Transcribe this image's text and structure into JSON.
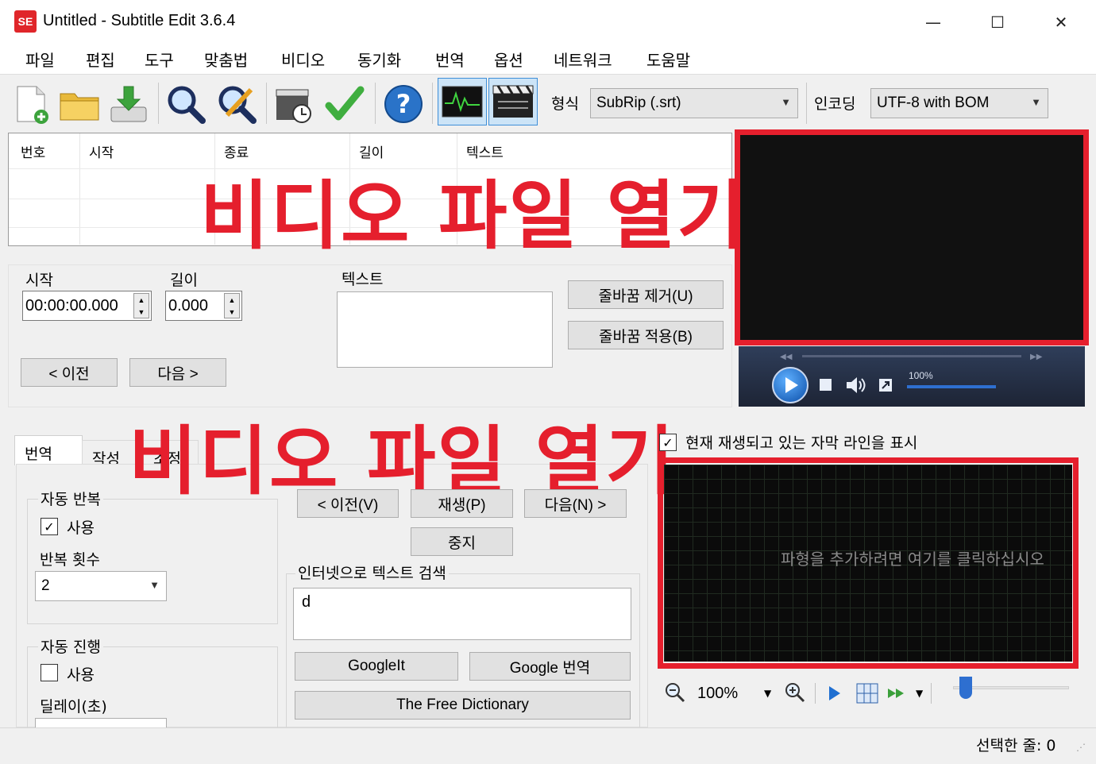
{
  "window": {
    "icon_text": "SE",
    "title": "Untitled - Subtitle Edit 3.6.4",
    "minimize": "—",
    "maximize": "☐",
    "close": "✕"
  },
  "menu": [
    "파일",
    "편집",
    "도구",
    "맞춤법",
    "비디오",
    "동기화",
    "번역",
    "옵션",
    "네트워크",
    "도움말"
  ],
  "toolbar": {
    "format_label": "형식",
    "format_value": "SubRip (.srt)",
    "encoding_label": "인코딩",
    "encoding_value": "UTF-8 with BOM",
    "icons": [
      "new-file-icon",
      "open-folder-icon",
      "save-icon",
      "find-icon",
      "replace-icon",
      "visual-sync-icon",
      "spell-check-icon",
      "help-icon",
      "waveform-toggle-icon",
      "video-toggle-icon"
    ]
  },
  "subtitle_list": {
    "columns": [
      "번호",
      "시작",
      "종료",
      "길이",
      "텍스트"
    ]
  },
  "overlay": {
    "top_text": "비디오 파일 열기",
    "middle_text": "비디오 파일 열기"
  },
  "edit": {
    "start_label": "시작",
    "start_value": "00:00:00.000",
    "duration_label": "길이",
    "duration_value": "0.000",
    "text_label": "텍스트",
    "prev_button": "< 이전",
    "next_button": "다음 >",
    "remove_linebreak": "줄바꿈 제거(U)",
    "apply_linebreak": "줄바꿈 적용(B)"
  },
  "player": {
    "volume_percent": "100%"
  },
  "tabs": {
    "items": [
      "번역",
      "작성",
      "조정"
    ],
    "auto_repeat": {
      "title": "자동 반복",
      "use_label": "사용",
      "use_checked": "✓",
      "count_label": "반복 횟수",
      "count_value": "2"
    },
    "auto_continue": {
      "title": "자동 진행",
      "use_label": "사용",
      "delay_label": "딜레이(초)"
    },
    "nav": {
      "prev": "< 이전(V)",
      "play": "재생(P)",
      "next": "다음(N) >",
      "stop": "중지"
    },
    "search": {
      "title": "인터넷으로 텍스트 검색",
      "value": "d",
      "googleit": "GoogleIt",
      "google_translate": "Google 번역",
      "free_dictionary": "The Free Dictionary"
    }
  },
  "waveform": {
    "show_current_line_label": "현재 재생되고 있는 자막 라인을 표시",
    "show_current_checked": "✓",
    "placeholder": "파형을 추가하려면 여기를 클릭하십시오",
    "zoom_value": "100%"
  },
  "status": {
    "selected_lines": "선택한 줄: 0"
  }
}
